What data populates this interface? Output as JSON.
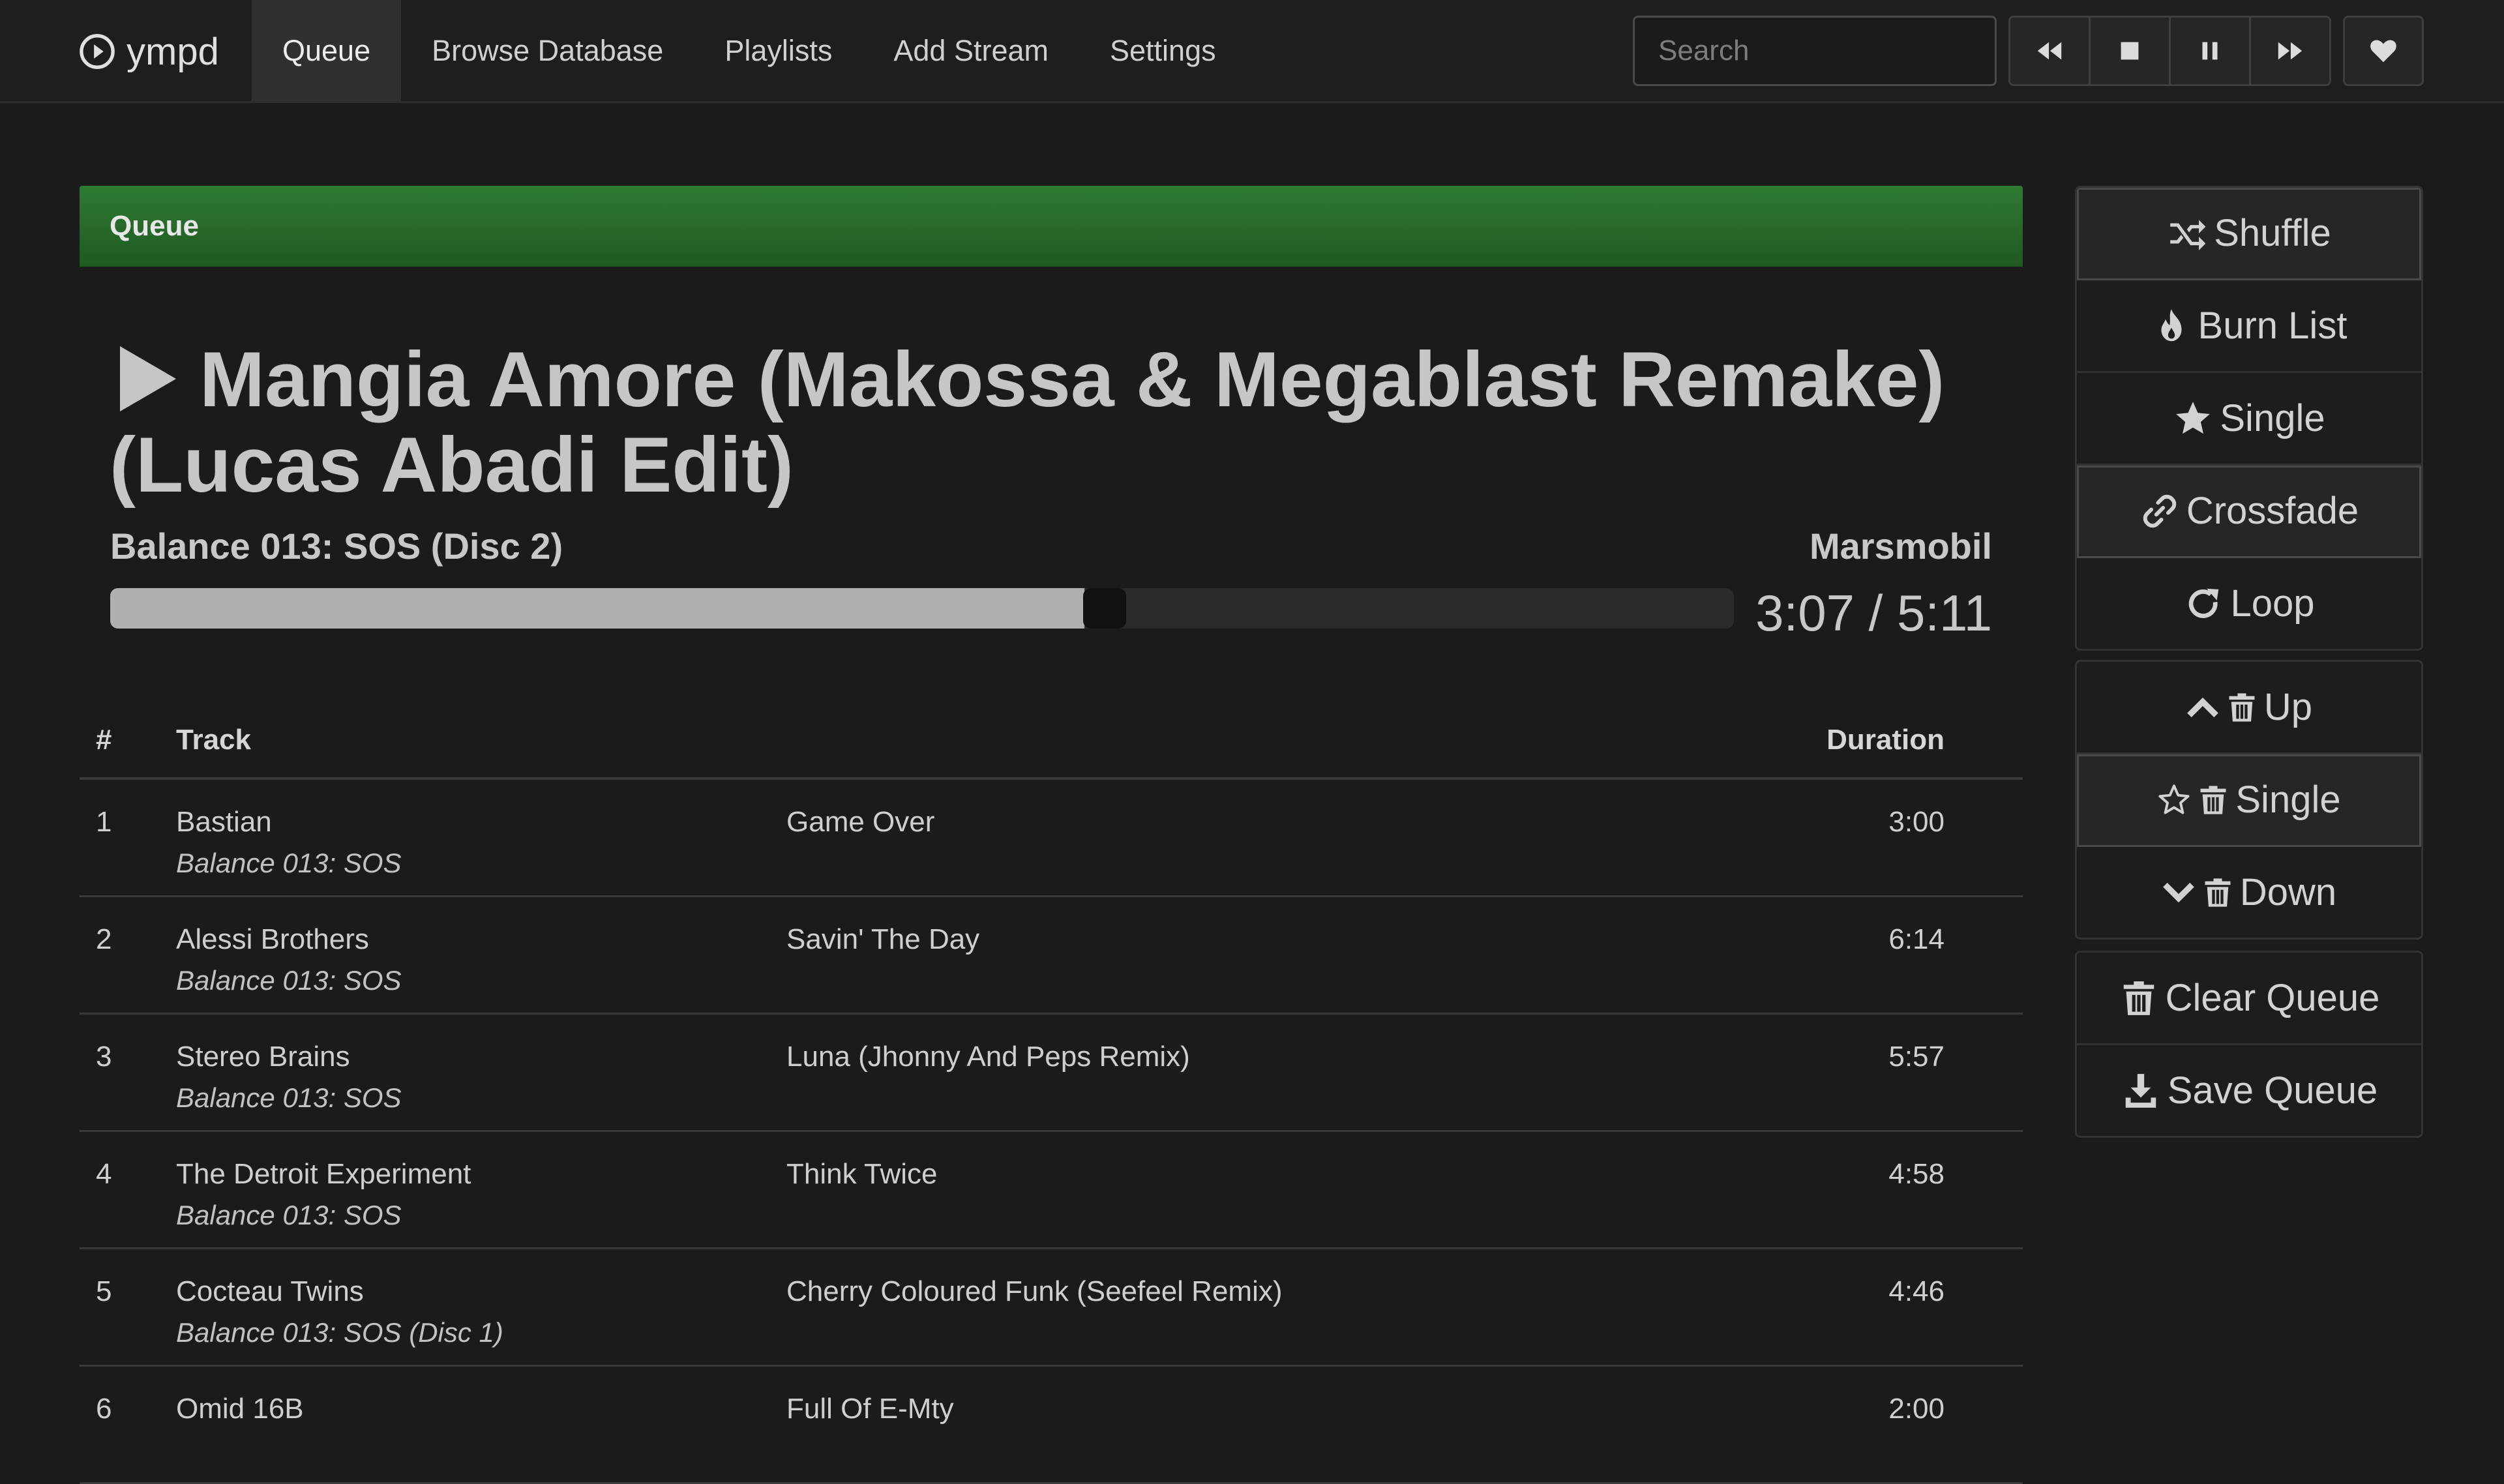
{
  "brand": {
    "name": "ympd"
  },
  "nav": {
    "items": [
      {
        "label": "Queue",
        "active": true
      },
      {
        "label": "Browse Database",
        "active": false
      },
      {
        "label": "Playlists",
        "active": false
      },
      {
        "label": "Add Stream",
        "active": false
      },
      {
        "label": "Settings",
        "active": false
      }
    ]
  },
  "search": {
    "placeholder": "Search",
    "value": ""
  },
  "transport": {
    "icons": [
      "previous-icon",
      "stop-icon",
      "pause-icon",
      "next-icon",
      "heart-icon"
    ]
  },
  "panel": {
    "heading": "Queue"
  },
  "now_playing": {
    "title": "Mangia Amore (Makossa & Megablast Remake) (Lucas Abadi Edit)",
    "album": "Balance 013: SOS (Disc 2)",
    "artist": "Marsmobil",
    "elapsed": "3:07 / 5:11",
    "progress_fraction": 0.6
  },
  "table": {
    "headers": {
      "num": "#",
      "track": "Track",
      "duration": "Duration"
    },
    "rows": [
      {
        "num": "1",
        "artist": "Bastian",
        "album": "Balance 013: SOS",
        "title": "Game Over",
        "duration": "3:00"
      },
      {
        "num": "2",
        "artist": "Alessi Brothers",
        "album": "Balance 013: SOS",
        "title": "Savin' The Day",
        "duration": "6:14"
      },
      {
        "num": "3",
        "artist": "Stereo Brains",
        "album": "Balance 013: SOS",
        "title": "Luna (Jhonny And Peps Remix)",
        "duration": "5:57"
      },
      {
        "num": "4",
        "artist": "The Detroit Experiment",
        "album": "Balance 013: SOS",
        "title": "Think Twice",
        "duration": "4:58"
      },
      {
        "num": "5",
        "artist": "Cocteau Twins",
        "album": "Balance 013: SOS (Disc 1)",
        "title": "Cherry Coloured Funk (Seefeel Remix)",
        "duration": "4:46"
      },
      {
        "num": "6",
        "artist": "Omid 16B",
        "album": "",
        "title": "Full Of E-Mty",
        "duration": "2:00"
      }
    ]
  },
  "sidebar": {
    "modes": [
      {
        "label": "Shuffle",
        "icon": "shuffle-icon"
      },
      {
        "label": "Burn List",
        "icon": "fire-icon"
      },
      {
        "label": "Single",
        "icon": "star-icon"
      },
      {
        "label": "Crossfade",
        "icon": "link-icon"
      },
      {
        "label": "Loop",
        "icon": "refresh-icon"
      }
    ],
    "remove": [
      {
        "label": "Up",
        "icon": "chevron-up-icon"
      },
      {
        "label": "Single",
        "icon": "star-outline-icon"
      },
      {
        "label": "Down",
        "icon": "chevron-down-icon"
      }
    ],
    "queue_actions": [
      {
        "label": "Clear Queue",
        "icon": "trash-icon"
      },
      {
        "label": "Save Queue",
        "icon": "download-icon"
      }
    ]
  },
  "colors": {
    "background": "#1b1b1b",
    "panel_heading": "#2f7a33",
    "progress_fill": "#b0b0b0"
  }
}
